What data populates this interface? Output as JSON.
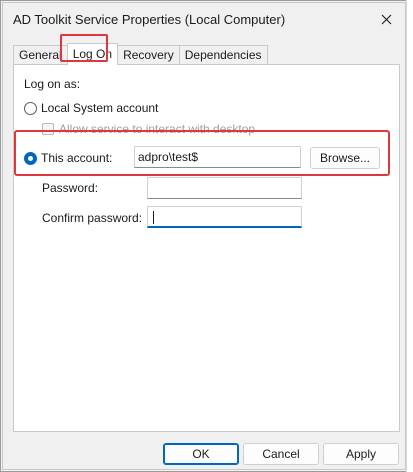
{
  "window": {
    "title": "AD Toolkit Service Properties (Local Computer)",
    "close_icon": "close-icon"
  },
  "tabs": [
    {
      "label": "General",
      "active": false
    },
    {
      "label": "Log On",
      "active": true
    },
    {
      "label": "Recovery",
      "active": false
    },
    {
      "label": "Dependencies",
      "active": false
    }
  ],
  "logon": {
    "heading": "Log on as:",
    "local_system": {
      "label": "Local System account",
      "selected": false
    },
    "interact_desktop": {
      "label": "Allow service to interact with desktop",
      "checked": false,
      "enabled": false
    },
    "this_account": {
      "label": "This account:",
      "selected": true,
      "value": "adpro\\test$"
    },
    "browse_label": "Browse...",
    "password": {
      "label": "Password:",
      "value": ""
    },
    "confirm_password": {
      "label": "Confirm password:",
      "value": ""
    }
  },
  "footer": {
    "ok_label": "OK",
    "cancel_label": "Cancel",
    "apply_label": "Apply"
  },
  "colors": {
    "highlight": "#e0363c",
    "accent": "#0067c0"
  }
}
